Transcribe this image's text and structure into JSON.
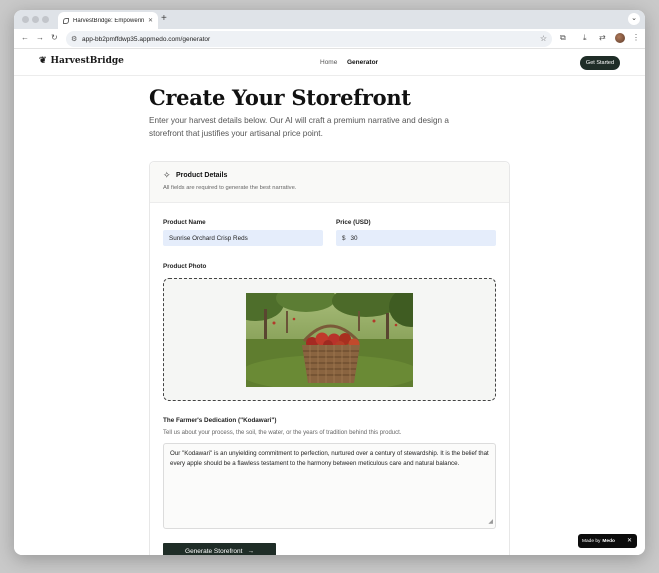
{
  "browser": {
    "tab_title": "HarvestBridge: Empowering",
    "url": "app-bb2pmffdwp35.appmedo.com/generator"
  },
  "site": {
    "brand": "HarvestBridge",
    "nav": [
      "Home",
      "Generator"
    ],
    "cta": "Get Started"
  },
  "page": {
    "title": "Create Your Storefront",
    "subtitle": "Enter your harvest details below. Our AI will craft a premium narrative and design a storefront that justifies your artisanal price point."
  },
  "card": {
    "title": "Product Details",
    "subtitle": "All fields are required to generate the best narrative."
  },
  "form": {
    "product_name_label": "Product Name",
    "product_name_value": "Sunrise Orchard Crisp Reds",
    "price_label": "Price (USD)",
    "currency": "$",
    "price_value": "30",
    "photo_label": "Product Photo",
    "dedication_label": "The Farmer's Dedication (\"Kodawari\")",
    "dedication_help": "Tell us about your process, the soil, the water, or the years of tradition behind this product.",
    "dedication_value": "Our \"Kodawari\" is an unyielding commitment to perfection, nurtured over a century of stewardship. It is the belief that every apple should be a flawless testament to the harmony between meticulous care and natural balance.",
    "submit": "Generate Storefront"
  },
  "badge": {
    "made_by": "Made by",
    "brand": "Medo"
  },
  "colors": {
    "accent": "#1f2d27",
    "input_bg": "#e5edfb"
  }
}
